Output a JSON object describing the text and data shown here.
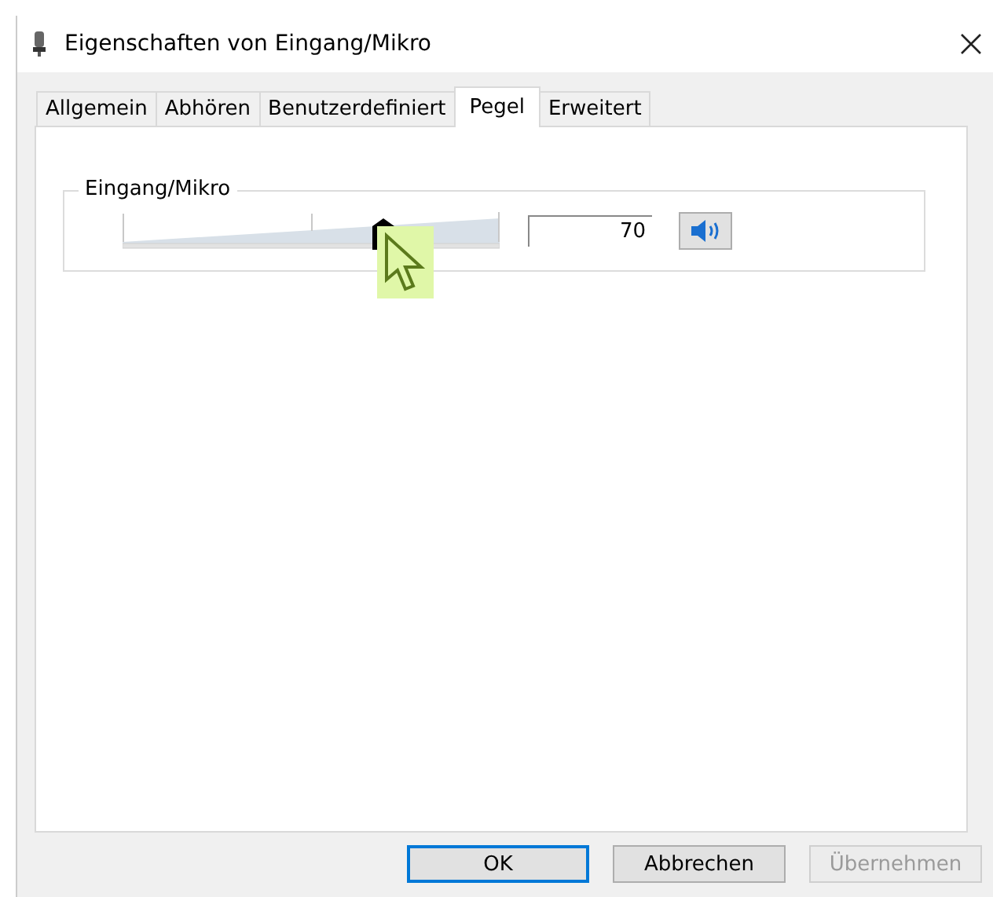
{
  "window": {
    "title": "Eigenschaften von Eingang/Mikro"
  },
  "tabs": [
    {
      "label": "Allgemein",
      "selected": false
    },
    {
      "label": "Abhören",
      "selected": false
    },
    {
      "label": "Benutzerdefiniert",
      "selected": false
    },
    {
      "label": "Pegel",
      "selected": true
    },
    {
      "label": "Erweitert",
      "selected": false
    }
  ],
  "level_group": {
    "title": "Eingang/Mikro",
    "level": 0.69,
    "value": "70",
    "muted": false
  },
  "buttons": [
    {
      "label": "OK",
      "kind": "default",
      "disabled": false
    },
    {
      "label": "Abbrechen",
      "kind": "normal",
      "disabled": false
    },
    {
      "label": "Übernehmen",
      "kind": "normal",
      "disabled": true
    }
  ]
}
